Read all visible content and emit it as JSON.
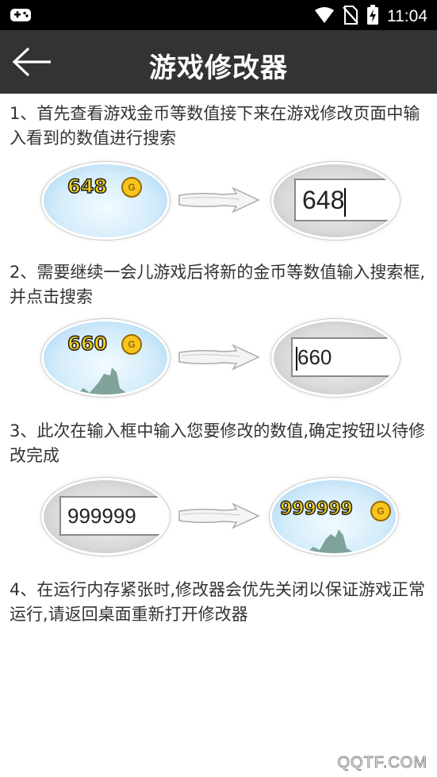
{
  "status_bar": {
    "time": "11:04",
    "icons": [
      "game-controller-icon",
      "wifi-icon",
      "no-sim-icon",
      "battery-charging-icon"
    ]
  },
  "app_bar": {
    "back_icon": "back-arrow-icon",
    "title": "游戏修改器"
  },
  "steps": [
    {
      "text": "1、首先查看游戏金币等数值接下来在游戏修改页面中输入看到的数值进行搜索",
      "left_value": "648",
      "right_value": "648"
    },
    {
      "text": "2、需要继续一会儿游戏后将新的金币等数值输入搜索框,并点击搜索",
      "left_value": "660",
      "right_value": "660"
    },
    {
      "text": "3、此次在输入框中输入您要修改的数值,确定按钮以待修改完成",
      "left_value": "999999",
      "right_value": "999999"
    },
    {
      "text": "4、在运行内存紧张时,修改器会优先关闭以保证游戏正常运行,请返回桌面重新打开修改器"
    }
  ],
  "coin_letter": "G",
  "watermark": "QQTF.COM",
  "colors": {
    "status_bar": "#000000",
    "app_bar": "#333333",
    "coin_text": "#f6d21a"
  }
}
